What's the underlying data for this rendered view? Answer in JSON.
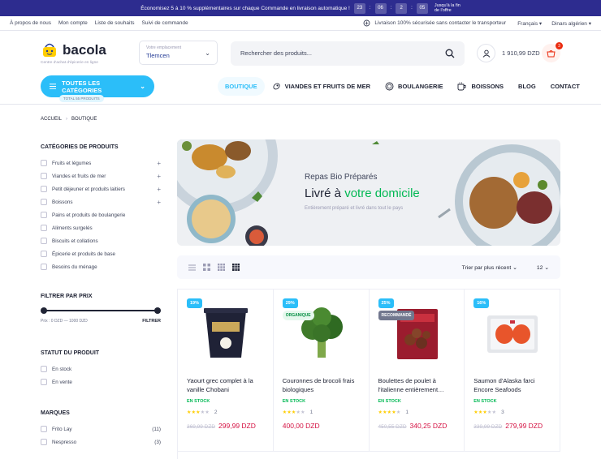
{
  "topbar": {
    "promo": "Économisez 5 à 10 % supplémentaires sur chaque Commande en livraison automatique !",
    "countdown": [
      "23",
      "06",
      "2",
      "05"
    ],
    "offer_end": [
      "Jusqu'à la fin",
      "de l'offre"
    ]
  },
  "toplinks": [
    "À propos de nous",
    "Mon compte",
    "Liste de souhaits",
    "Suivi de commande"
  ],
  "delivery_note": "Livraison 100% sécurisée sans contacter le transporteur",
  "language": "Français",
  "currency": "Dinars algérien",
  "logo": {
    "name": "bacola",
    "tagline": "Centre d'achat d'épicerie en ligne"
  },
  "location": {
    "label": "Votre emplacement",
    "value": "Tlemcen"
  },
  "search": {
    "placeholder": "Rechercher des produits..."
  },
  "cart": {
    "total": "1 910,99 DZD",
    "count": "3"
  },
  "all_categories": {
    "label": "TOUTES LES CATÉGORIES",
    "sub": "TOTAL 55 PRODUITS"
  },
  "menu": [
    {
      "label": "BOUTIQUE",
      "icon": ""
    },
    {
      "label": "VIANDES ET FRUITS DE MER",
      "icon": "meat-icon"
    },
    {
      "label": "BOULANGERIE",
      "icon": "bread-icon"
    },
    {
      "label": "BOISSONS",
      "icon": "cup-icon"
    },
    {
      "label": "BLOG",
      "icon": ""
    },
    {
      "label": "CONTACT",
      "icon": ""
    }
  ],
  "breadcrumb": [
    "ACCUEIL",
    "BOUTIQUE"
  ],
  "sidebar": {
    "categories_title": "CATÉGORIES DE PRODUITS",
    "categories": [
      {
        "label": "Fruits et légumes",
        "expandable": true
      },
      {
        "label": "Viandes et fruits de mer",
        "expandable": true
      },
      {
        "label": "Petit déjeuner et produits laitiers",
        "expandable": true
      },
      {
        "label": "Boissons",
        "expandable": true
      },
      {
        "label": "Pains et produits de boulangerie",
        "expandable": false
      },
      {
        "label": "Aliments surgelés",
        "expandable": false
      },
      {
        "label": "Biscuits et collations",
        "expandable": false
      },
      {
        "label": "Épicerie et produits de base",
        "expandable": false
      },
      {
        "label": "Besoins du ménage",
        "expandable": false
      }
    ],
    "price_title": "FILTRER PAR PRIX",
    "price_label": "Prix :",
    "price_range": "0 DZD — 1000 DZD",
    "filter_button": "FILTRER",
    "status_title": "STATUT DU PRODUIT",
    "status": [
      "En stock",
      "En vente"
    ],
    "brands_title": "MARQUES",
    "brands": [
      {
        "label": "Frito Lay",
        "count": "(11)"
      },
      {
        "label": "Nespresso",
        "count": "(3)"
      }
    ]
  },
  "banner": {
    "line1": "Repas Bio Préparés",
    "line2a": "Livré à ",
    "line2b": "votre domicile",
    "line3": "Entièrement préparé et livré dans tout le pays"
  },
  "toolbar": {
    "sort": "Trier par plus récent",
    "per_page": "12"
  },
  "products": [
    {
      "discount": "19%",
      "tag": "",
      "name": "Yaourt grec complet à la vanille Chobani",
      "stock": "EN STOCK",
      "stars": 3,
      "reviews": "2",
      "old_price": "369,99 DZD",
      "price": "299,99 DZD"
    },
    {
      "discount": "29%",
      "tag": "ORGANIQUE",
      "name": "Couronnes de brocoli frais biologiques",
      "stock": "EN STOCK",
      "stars": 3,
      "reviews": "1",
      "old_price": "",
      "price": "400,00 DZD"
    },
    {
      "discount": "25%",
      "tag": "RECOMMANDÉ",
      "name": "Boulettes de poulet à l'italienne entièrement…",
      "stock": "EN STOCK",
      "stars": 4,
      "reviews": "1",
      "old_price": "450,55 DZD",
      "price": "340,25 DZD"
    },
    {
      "discount": "16%",
      "tag": "",
      "name": "Saumon d'Alaska farci Encore Seafoods",
      "stock": "EN STOCK",
      "stars": 3,
      "reviews": "3",
      "old_price": "339,99 DZD",
      "price": "279,99 DZD"
    }
  ],
  "colors": {
    "primary": "#2bbef9",
    "topbar": "#2d2c8f",
    "sale": "#d51243",
    "stock": "#00b853"
  }
}
